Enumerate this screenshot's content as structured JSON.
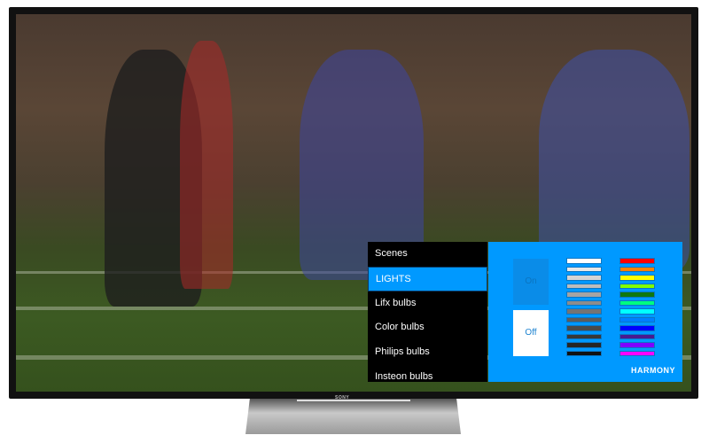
{
  "brand": "SONY",
  "menu": {
    "items": [
      {
        "label": "Scenes",
        "selected": false
      },
      {
        "label": "LIGHTS",
        "selected": true
      },
      {
        "label": "Lifx bulbs",
        "selected": false
      },
      {
        "label": "Color bulbs",
        "selected": false
      },
      {
        "label": "Philips bulbs",
        "selected": false
      },
      {
        "label": "Insteon bulbs",
        "selected": false
      }
    ]
  },
  "lights": {
    "on_label": "On",
    "off_label": "Off",
    "gray_swatches": [
      "#ffffff",
      "#e8e8e8",
      "#d4d4d4",
      "#bcbcbc",
      "#a4a4a4",
      "#8c8c8c",
      "#747474",
      "#5c5c5c",
      "#4a4a4a",
      "#383838",
      "#262626",
      "#111111"
    ],
    "color_swatches": [
      "#ff0000",
      "#ff8000",
      "#ffff00",
      "#80ff00",
      "#107810",
      "#00ff80",
      "#00ffff",
      "#0080ff",
      "#0000ff",
      "#4a1a90",
      "#8000ff",
      "#ff00ff"
    ],
    "logo": "HARMONY"
  },
  "colors": {
    "accent": "#0099ff"
  }
}
